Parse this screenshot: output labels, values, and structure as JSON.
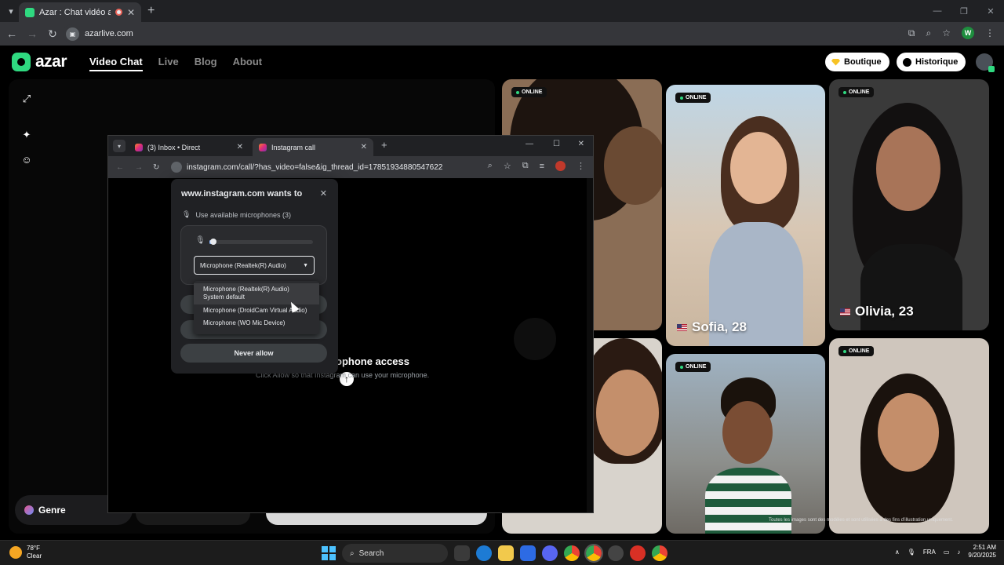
{
  "outer_browser": {
    "tab_title": "Azar : Chat vidéo avec de n",
    "url": "azarlive.com",
    "profile_initial": "W"
  },
  "azar": {
    "logo": "azar",
    "nav": [
      "Video Chat",
      "Live",
      "Blog",
      "About"
    ],
    "boutique_label": "Boutique",
    "historique_label": "Historique",
    "genre_label": "Genre",
    "online_label": "ONLINE",
    "profiles": [
      {
        "name": "Sofia, 28"
      },
      {
        "name": "Olivia, 23"
      }
    ],
    "disclaimer": "Toutes les images sont des modèles et sont utilisées à des fins d'illustration uniquement."
  },
  "inner_browser": {
    "tabs": [
      {
        "label": "(3) Inbox • Direct"
      },
      {
        "label": "Instagram call"
      }
    ],
    "url": "instagram.com/call/?has_video=false&ig_thread_id=17851934880547622",
    "page_title": "ophone access",
    "page_sub": "Click Allow so that Instagram can use your microphone."
  },
  "permission": {
    "title": "www.instagram.com wants to",
    "use_label": "Use available microphones (3)",
    "selected": "Microphone (Realtek(R) Audio)",
    "options": [
      "Microphone (Realtek(R) Audio)",
      "System default",
      "Microphone (DroidCam Virtual Audio)",
      "Microphone (WO Mic Device)"
    ],
    "never_allow": "Never allow",
    "level": 0.02
  },
  "taskbar": {
    "temp": "78°F",
    "condition": "Clear",
    "search": "Search",
    "lang": "FRA",
    "time": "2:51 AM",
    "date": "9/20/2025"
  }
}
